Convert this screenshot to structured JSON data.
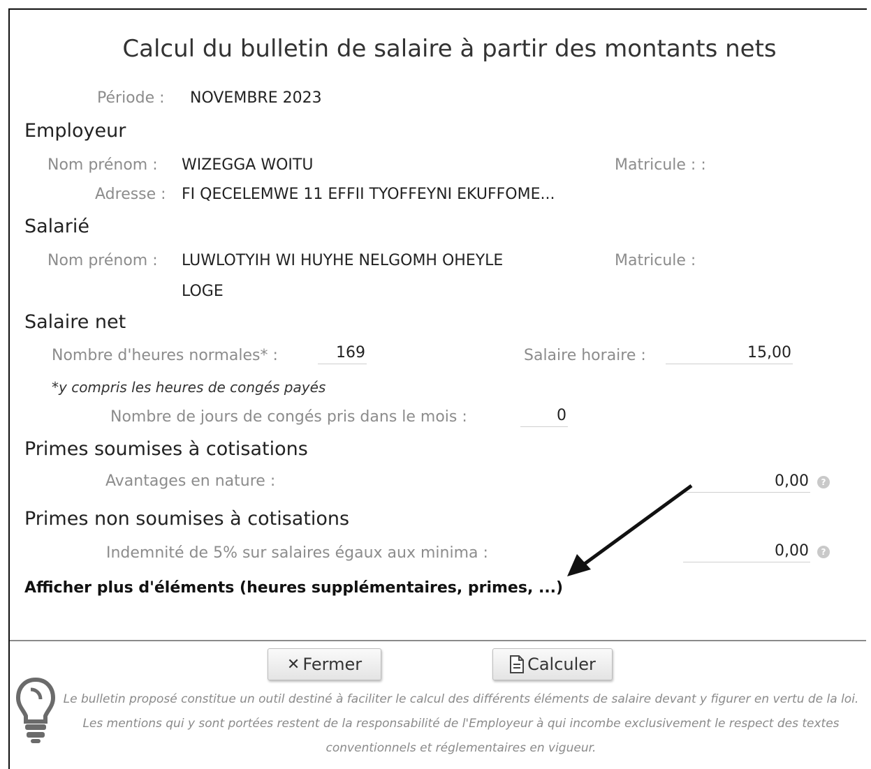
{
  "title": "Calcul du bulletin de salaire à partir des montants nets",
  "periode": {
    "label": "Période :",
    "value": "NOVEMBRE 2023"
  },
  "employeur": {
    "heading": "Employeur",
    "nom_label": "Nom prénom :",
    "nom_value": "WIZEGGA WOITU",
    "matricule_label": "Matricule : :",
    "adresse_label": "Adresse :",
    "adresse_value": "FI QECELEMWE 11 EFFII TYOFFEYNI EKUFFOME..."
  },
  "salarie": {
    "heading": "Salarié",
    "nom_label": "Nom prénom :",
    "nom_value_line1": "LUWLOTYIH WI HUYHE NELGOMH OHEYLE",
    "nom_value_line2": "LOGE",
    "matricule_label": "Matricule :"
  },
  "salaire_net": {
    "heading": "Salaire net",
    "heures_label": "Nombre d'heures normales* :",
    "heures_value": "169",
    "horaire_label": "Salaire horaire :",
    "horaire_value": "15,00",
    "note": "*y compris les heures de congés payés",
    "conges_label": "Nombre de jours de congés pris dans le mois :",
    "conges_value": "0"
  },
  "primes_soumises": {
    "heading": "Primes soumises à cotisations",
    "avantages_label": "Avantages en nature :",
    "avantages_value": "0,00"
  },
  "primes_non_soumises": {
    "heading": "Primes non soumises à cotisations",
    "indemnite_label": "Indemnité de 5% sur salaires égaux aux minima :",
    "indemnite_value": "0,00"
  },
  "more_link": "Afficher plus d'éléments (heures supplémentaires, primes, ...)",
  "buttons": {
    "fermer": "Fermer",
    "calculer": "Calculer"
  },
  "icons": {
    "info": "info-icon",
    "close": "close-icon",
    "document": "document-icon",
    "lightbulb": "lightbulb-icon",
    "arrow": "arrow-annotation-icon"
  },
  "disclaimer": "Le bulletin proposé constitue un outil destiné à faciliter le calcul des différents éléments de salaire devant y figurer en vertu de la loi. Les mentions qui y sont portées restent de la responsabilité de l'Employeur à qui incombe exclusivement le respect des textes conventionnels et réglementaires en vigueur."
}
